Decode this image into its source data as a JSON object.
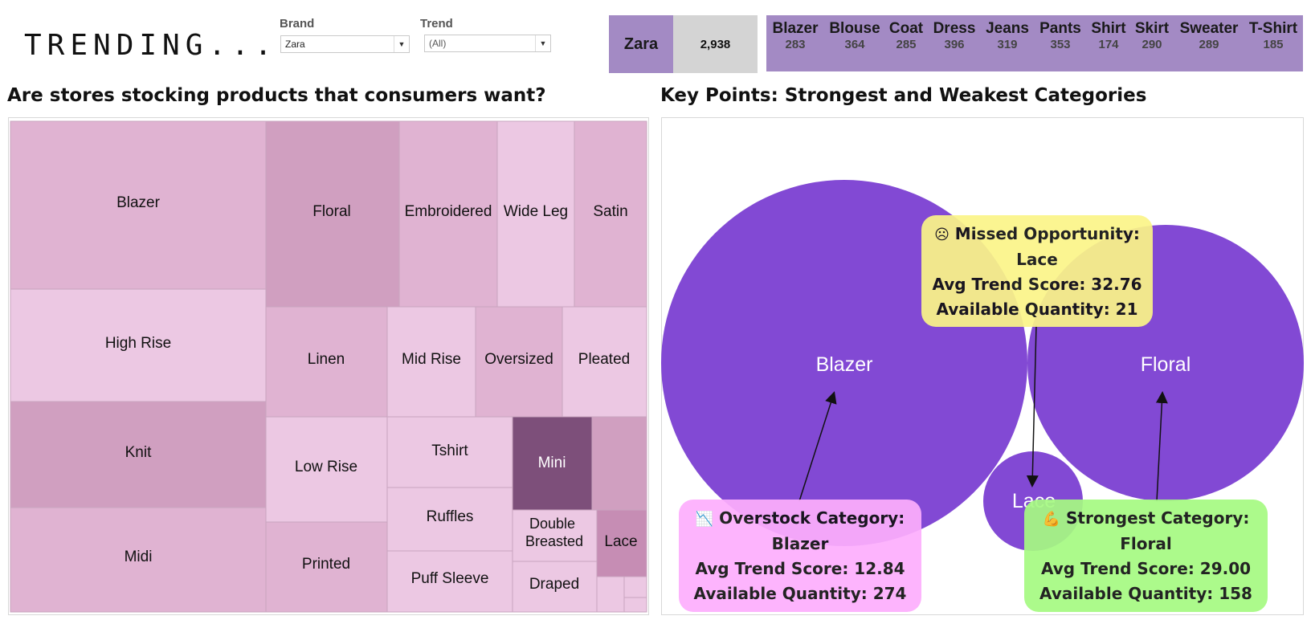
{
  "header": {
    "logo": "TRENDING...",
    "brand_filter": {
      "label": "Brand",
      "value": "Zara"
    },
    "trend_filter": {
      "label": "Trend",
      "value": "(All)"
    },
    "kpi": {
      "brand": "Zara",
      "total": "2,938",
      "categories": [
        {
          "name": "Blazer",
          "value": "283"
        },
        {
          "name": "Blouse",
          "value": "364"
        },
        {
          "name": "Coat",
          "value": "285"
        },
        {
          "name": "Dress",
          "value": "396"
        },
        {
          "name": "Jeans",
          "value": "319"
        },
        {
          "name": "Pants",
          "value": "353"
        },
        {
          "name": "Shirt",
          "value": "174"
        },
        {
          "name": "Skirt",
          "value": "290"
        },
        {
          "name": "Sweater",
          "value": "289"
        },
        {
          "name": "T-Shirt",
          "value": "185"
        }
      ]
    }
  },
  "left_title": "Are stores stocking products that consumers want?",
  "right_title": "Key Points: Strongest and Weakest Categories",
  "colors": {
    "accent": "#a38ac4",
    "bubble": "#8249d4",
    "tile_light": "#ecc8e3",
    "tile_mid": "#e0b3d2",
    "tile_dark": "#d09fc0",
    "tile_darkest": "#7d4f7a",
    "tile_lace": "#c68db4"
  },
  "chart_data": [
    {
      "type": "treemap",
      "title": "Are stores stocking products that consumers want?",
      "tiles": [
        {
          "label": "Blazer"
        },
        {
          "label": "High Rise"
        },
        {
          "label": "Knit"
        },
        {
          "label": "Midi"
        },
        {
          "label": "Floral"
        },
        {
          "label": "Embroidered"
        },
        {
          "label": "Wide Leg"
        },
        {
          "label": "Satin"
        },
        {
          "label": "Linen"
        },
        {
          "label": "Mid Rise"
        },
        {
          "label": "Oversized"
        },
        {
          "label": "Pleated"
        },
        {
          "label": "Low Rise"
        },
        {
          "label": "Tshirt"
        },
        {
          "label": "Mini"
        },
        {
          "label": "Ruffles"
        },
        {
          "label": "Double Breasted"
        },
        {
          "label": "Lace"
        },
        {
          "label": "Printed"
        },
        {
          "label": "Puff Sleeve"
        },
        {
          "label": "Draped"
        }
      ]
    },
    {
      "type": "bubble",
      "title": "Key Points: Strongest and Weakest Categories",
      "bubbles": [
        {
          "label": "Blazer",
          "avg_trend_score": 12.84,
          "available_quantity": 274
        },
        {
          "label": "Floral",
          "avg_trend_score": 29.0,
          "available_quantity": 158
        },
        {
          "label": "Lace",
          "avg_trend_score": 32.76,
          "available_quantity": 21
        }
      ],
      "annotations": [
        {
          "icon": "☹",
          "heading": "Missed Opportunity:",
          "category": "Lace",
          "score_line": "Avg Trend Score: 32.76",
          "qty_line": "Available Quantity: 21",
          "color": "#fbf588"
        },
        {
          "icon": "📉",
          "heading": "Overstock Category:",
          "category": "Blazer",
          "score_line": "Avg Trend Score: 12.84",
          "qty_line": "Available Quantity: 274",
          "color": "#fdaefd"
        },
        {
          "icon": "💪",
          "heading": "Strongest Category:",
          "category": "Floral",
          "score_line": "Avg Trend Score: 29.00",
          "qty_line": "Available Quantity: 158",
          "color": "#a6fa82"
        }
      ]
    }
  ]
}
